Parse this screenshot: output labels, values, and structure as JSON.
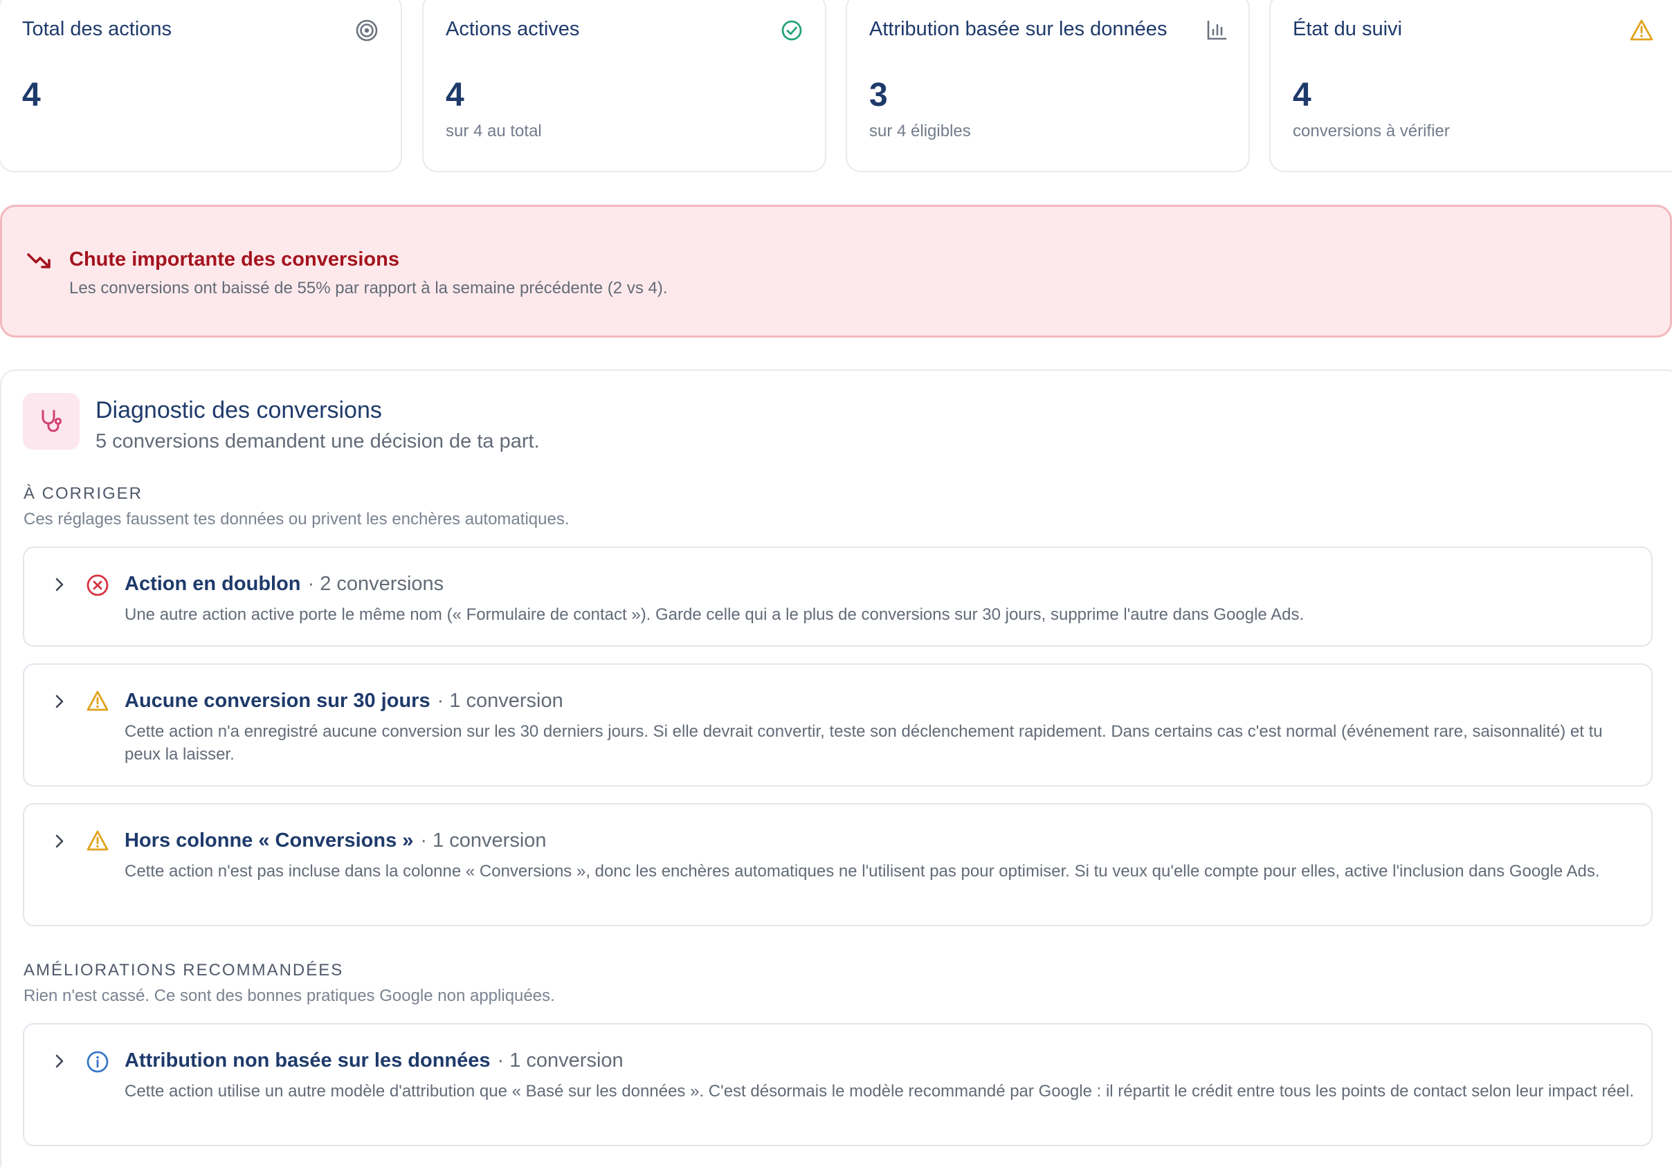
{
  "stats": [
    {
      "title": "Total des actions",
      "value": "4",
      "sub": "",
      "icon": "target-icon"
    },
    {
      "title": "Actions actives",
      "value": "4",
      "sub": "sur 4 au total",
      "icon": "check-circle-icon"
    },
    {
      "title": "Attribution basée sur les données",
      "value": "3",
      "sub": "sur 4 éligibles",
      "icon": "bar-chart-icon"
    },
    {
      "title": "État du suivi",
      "value": "4",
      "sub": "conversions à vérifier",
      "icon": "warning-icon"
    }
  ],
  "alert": {
    "title": "Chute importante des conversions",
    "text": "Les conversions ont baissé de 55% par rapport à la semaine précédente (2 vs 4).",
    "icon": "trending-down-icon"
  },
  "diagnostic": {
    "title": "Diagnostic des conversions",
    "subtitle": "5 conversions demandent une décision de ta part.",
    "icon": "stethoscope-icon",
    "fix": {
      "heading": "À CORRIGER",
      "description": "Ces réglages faussent tes données ou privent les enchères automatiques.",
      "items": [
        {
          "title": "Action en doublon",
          "count": "· 2 conversions",
          "icon": "error-circle-icon",
          "text": "Une autre action active porte le même nom (« Formulaire de contact »). Garde celle qui a le plus de conversions sur 30 jours, supprime l'autre dans Google Ads."
        },
        {
          "title": "Aucune conversion sur 30 jours",
          "count": "· 1 conversion",
          "icon": "warning-icon",
          "text": "Cette action n'a enregistré aucune conversion sur les 30 derniers jours. Si elle devrait convertir, teste son déclenchement rapidement. Dans certains cas c'est normal (événement rare, saisonnalité) et tu peux la laisser."
        },
        {
          "title": "Hors colonne « Conversions »",
          "count": "· 1 conversion",
          "icon": "warning-icon",
          "text": "Cette action n'est pas incluse dans la colonne « Conversions », donc les enchères automatiques ne l'utilisent pas pour optimiser. Si tu veux qu'elle compte pour elles, active l'inclusion dans Google Ads."
        }
      ]
    },
    "improve": {
      "heading": "AMÉLIORATIONS RECOMMANDÉES",
      "description": "Rien n'est cassé. Ce sont des bonnes pratiques Google non appliquées.",
      "items": [
        {
          "title": "Attribution non basée sur les données",
          "count": "· 1 conversion",
          "icon": "info-icon",
          "text": "Cette action utilise un autre modèle d'attribution que « Basé sur les données ». C'est désormais le modèle recommandé par Google : il répartit le crédit entre tous les points de contact selon leur impact réel."
        }
      ]
    }
  },
  "colors": {
    "navy": "#1e3a6b",
    "danger": "#a3131f",
    "danger_bg": "#fde9eb",
    "warning": "#e0a21a",
    "success": "#22a37a",
    "info": "#3a78c8",
    "error": "#d6343f"
  }
}
